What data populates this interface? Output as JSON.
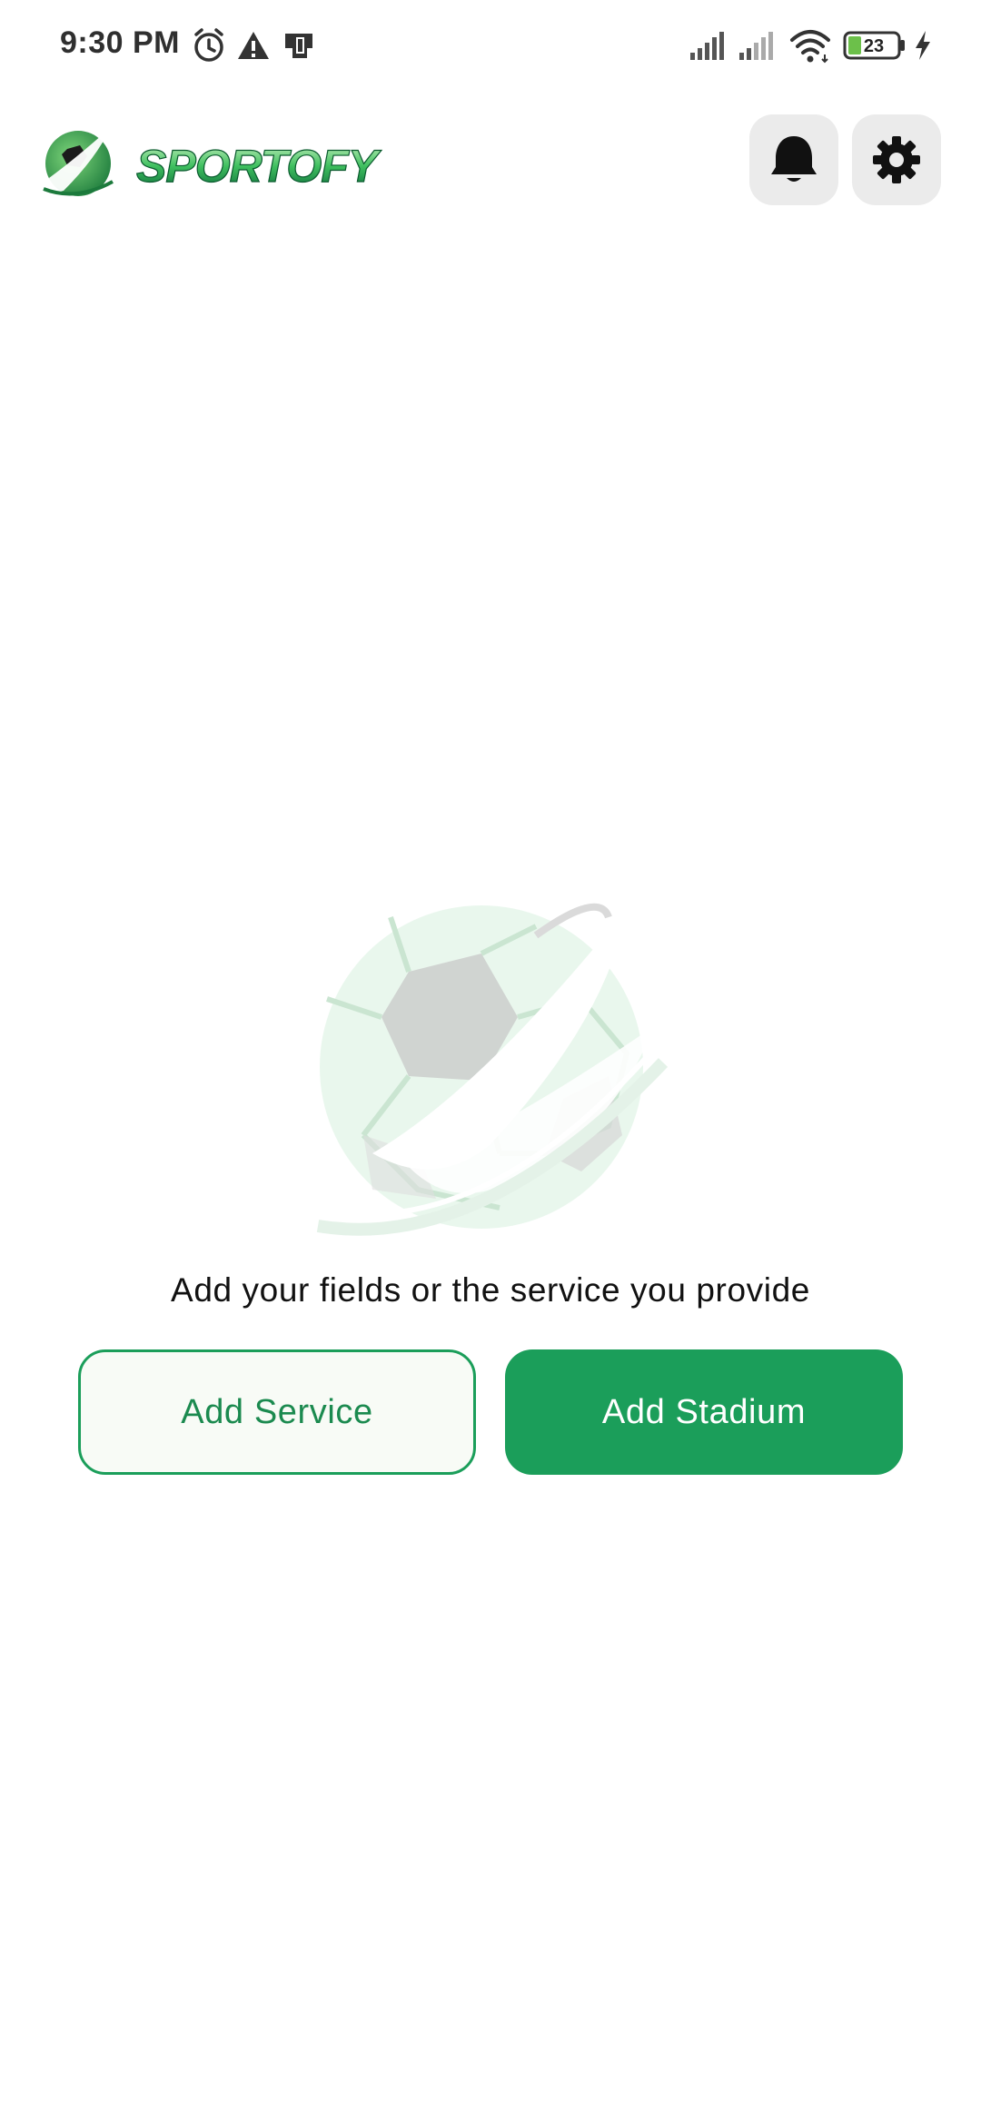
{
  "status_bar": {
    "time": "9:30 PM",
    "battery_level": "23",
    "icons": [
      "alarm-icon",
      "warning-icon",
      "sim-card-icon",
      "signal-icon",
      "signal-weak-icon",
      "wifi-icon",
      "battery-icon",
      "charging-icon"
    ]
  },
  "header": {
    "brand": "SPORTOFY",
    "buttons": [
      {
        "name": "notifications",
        "icon": "bell-icon"
      },
      {
        "name": "settings",
        "icon": "gear-icon"
      }
    ]
  },
  "empty_state": {
    "illustration": "soccer-ball-logo-watermark",
    "message": "Add your fields or the service you provide"
  },
  "actions": {
    "add_service_label": "Add Service",
    "add_stadium_label": "Add Stadium"
  },
  "colors": {
    "primary": "#1b9e5a",
    "button_bg_light": "#f8fbf6",
    "icon_button_bg": "#ebebeb"
  }
}
